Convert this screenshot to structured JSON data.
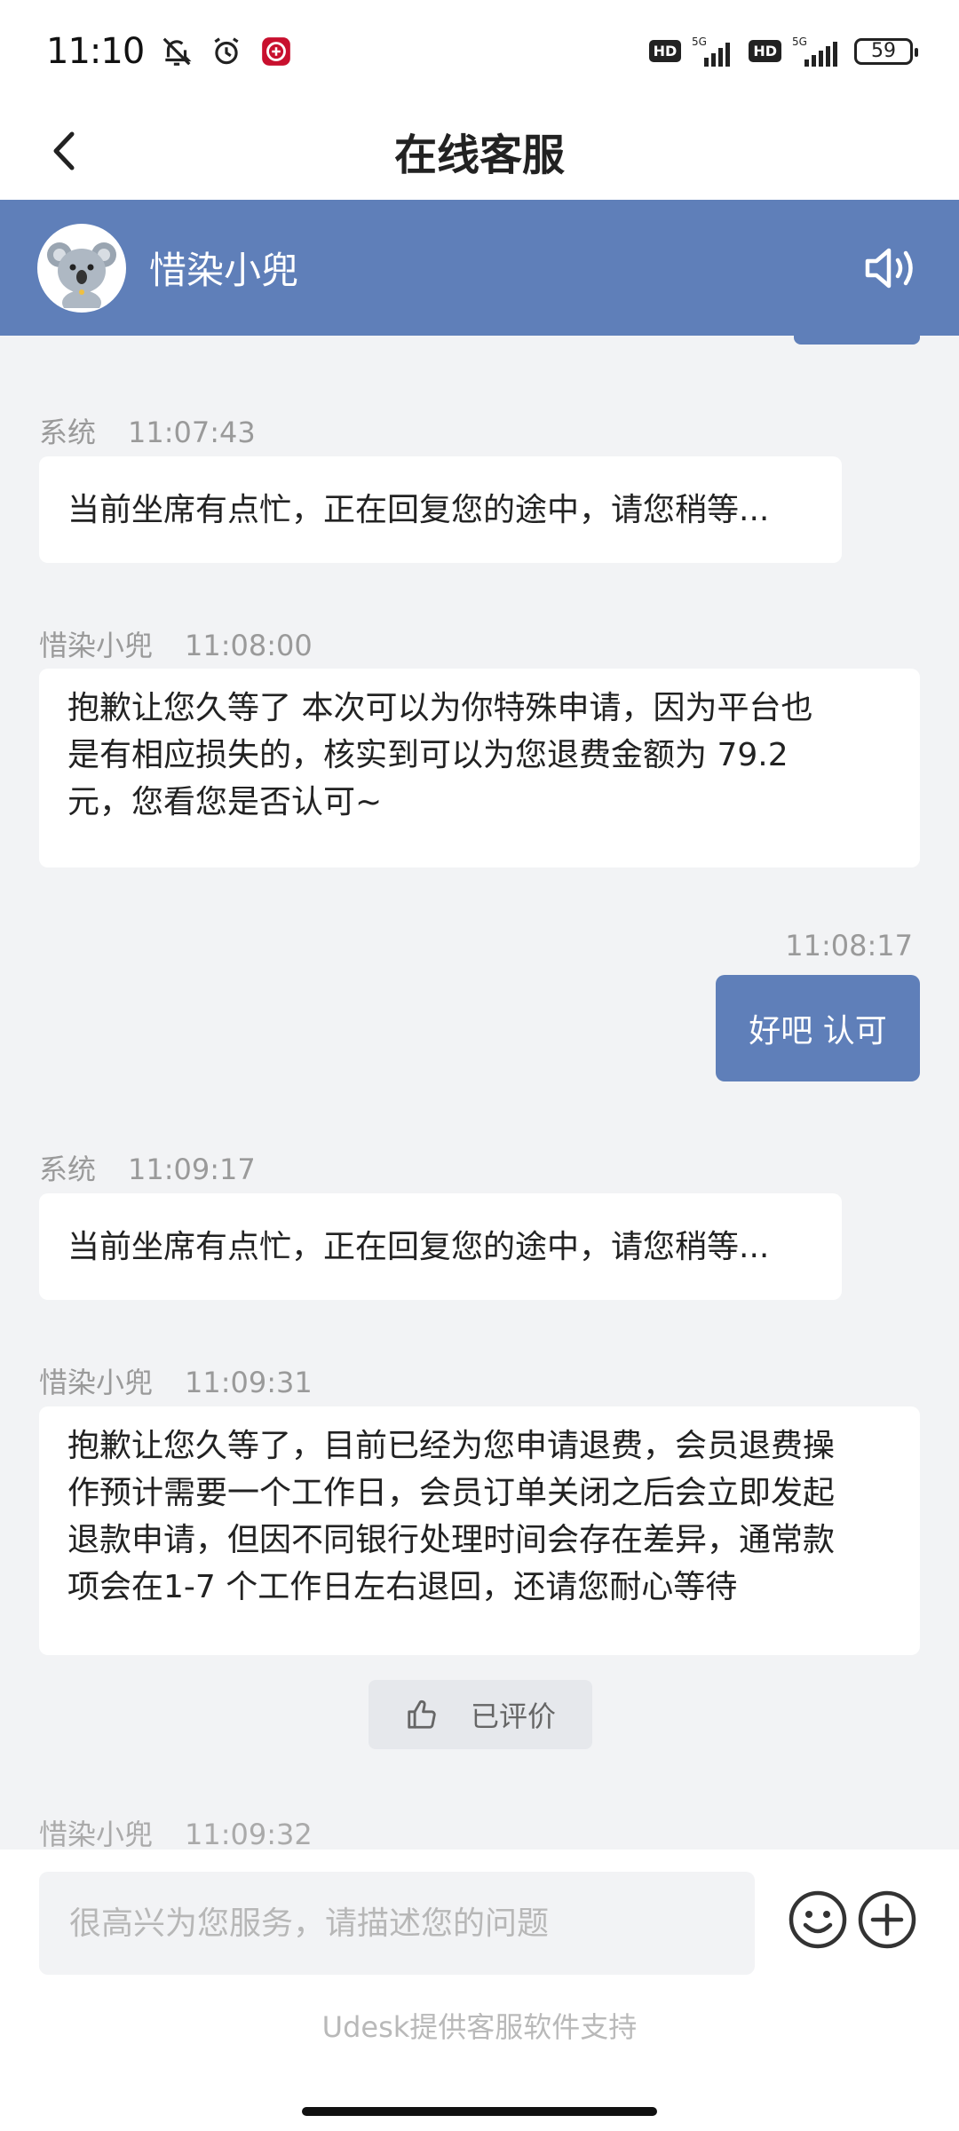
{
  "status_bar": {
    "time": "11:10",
    "network_left": "5G",
    "network_right": "5G",
    "hd_label": "HD",
    "battery": "59"
  },
  "nav": {
    "title": "在线客服"
  },
  "agent": {
    "name": "惜染小兜"
  },
  "messages": [
    {
      "sender": "系统",
      "time": "11:07:43",
      "text": "当前坐席有点忙，正在回复您的途中，请您稍等..."
    },
    {
      "sender": "惜染小兜",
      "time": "11:08:00",
      "lines": [
        "抱歉让您久等了 本次可以为你特殊申请，因为平台也",
        "是有相应损失的，核实到可以为您退费金额为 79.2",
        "元，您看您是否认可~"
      ]
    },
    {
      "sender": "user",
      "time": "11:08:17",
      "text": "好吧 认可"
    },
    {
      "sender": "系统",
      "time": "11:09:17",
      "text": "当前坐席有点忙，正在回复您的途中，请您稍等..."
    },
    {
      "sender": "惜染小兜",
      "time": "11:09:31",
      "lines": [
        "抱歉让您久等了，目前已经为您申请退费，会员退费操",
        "作预计需要一个工作日，会员订单关闭之后会立即发起",
        "退款申请，但因不同银行处理时间会存在差异，通常款",
        "项会在1-7 个工作日左右退回，还请您耐心等待"
      ]
    }
  ],
  "rated_label": "已评价",
  "partial_meta": {
    "sender": "惜染小兜",
    "time": "11:09:32"
  },
  "input": {
    "placeholder": "很高兴为您服务，请描述您的问题",
    "value": ""
  },
  "footer": {
    "powered_by": "Udesk提供客服软件支持"
  },
  "colors": {
    "accent": "#5f7fb9",
    "background": "#f2f3f5"
  }
}
